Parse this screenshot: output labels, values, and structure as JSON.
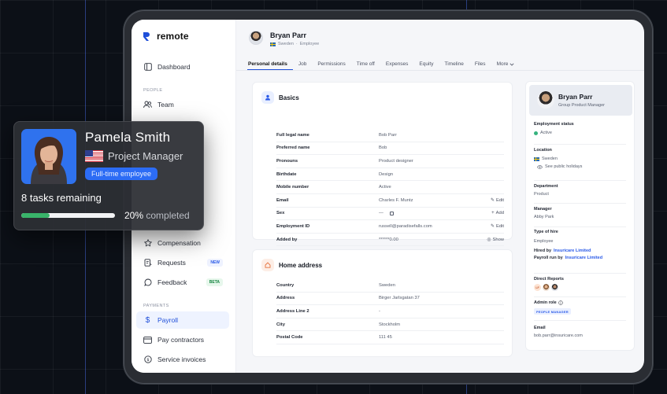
{
  "app": {
    "brand": "remote"
  },
  "sidebar": {
    "items": [
      {
        "label": "Dashboard",
        "icon": "layout-icon"
      },
      {
        "label": "Team",
        "icon": "users-icon"
      },
      {
        "label": "Compensation",
        "icon": "star-icon"
      },
      {
        "label": "Requests",
        "icon": "requests-icon",
        "badge": "NEW"
      },
      {
        "label": "Feedback",
        "icon": "chat-bubble-icon",
        "badge": "BETA"
      },
      {
        "label": "Payroll",
        "icon": "dollar-icon",
        "active": true
      },
      {
        "label": "Pay contractors",
        "icon": "card-icon"
      },
      {
        "label": "Service invoices",
        "icon": "invoice-icon"
      }
    ],
    "sections": {
      "people": "PEOPLE",
      "payments": "PAYMENTS"
    }
  },
  "header": {
    "name": "Bryan Parr",
    "country": "Sweden",
    "type": "Employee",
    "separator": "·",
    "tabs": [
      "Personal details",
      "Job",
      "Permissions",
      "Time off",
      "Expenses",
      "Equity",
      "Timeline",
      "Files",
      "More"
    ],
    "active_tab": "Personal details"
  },
  "basics": {
    "title": "Basics",
    "rows": [
      {
        "label": "Full legal name",
        "value": "Bob Parr",
        "action": ""
      },
      {
        "label": "Preferred name",
        "value": "Bob",
        "action": ""
      },
      {
        "label": "Pronouns",
        "value": "Product designer",
        "action": ""
      },
      {
        "label": "Birthdate",
        "value": "Design",
        "action": ""
      },
      {
        "label": "Mobile number",
        "value": "Active",
        "action": ""
      },
      {
        "label": "Email",
        "value": "Charles F. Muntz",
        "action": "Edit"
      },
      {
        "label": "Sex",
        "value": "—",
        "action": "Add"
      },
      {
        "label": "Employment ID",
        "value": "russell@paradisefalls.com",
        "action": "Edit"
      },
      {
        "label": "Added by",
        "value": "******0.00",
        "action": "Show"
      }
    ]
  },
  "home_address": {
    "title": "Home address",
    "rows": [
      {
        "label": "Country",
        "value": "Sweden"
      },
      {
        "label": "Address",
        "value": "Birger Jarlsgatan 37"
      },
      {
        "label": "Address Line 2",
        "value": "-"
      },
      {
        "label": "City",
        "value": "Stockholm"
      },
      {
        "label": "Postal Code",
        "value": "111 45"
      }
    ]
  },
  "profile_panel": {
    "name": "Bryan Parr",
    "role": "Group Product Manager",
    "employment_status": {
      "label": "Employment status",
      "value": "Active",
      "color": "#36b37e"
    },
    "location": {
      "label": "Location",
      "value": "Sweden",
      "link": "See public holidays"
    },
    "department": {
      "label": "Department",
      "value": "Product"
    },
    "manager": {
      "label": "Manager",
      "value": "Abby Park"
    },
    "type_of_hire": {
      "label": "Type of hire",
      "value": "Employee",
      "hired_by_prefix": "Hired by",
      "hired_by": "Insuricare Limited",
      "payroll_prefix": "Payroll run by",
      "payroll_by": "Insuricare Limited"
    },
    "direct_reports": {
      "label": "Direct Reports",
      "initials": "LF"
    },
    "admin_role": {
      "label": "Admin role",
      "badge": "PEOPLE MANAGER"
    },
    "email": {
      "label": "Email",
      "value": "bob.parr@insuricare.com"
    }
  },
  "float_card": {
    "name": "Pamela Smith",
    "role": "Project Manager",
    "badge": "Full-time employee",
    "tasks": "8 tasks remaining",
    "progress": 0.2,
    "progress_pct": "20%",
    "progress_suffix": " completed"
  },
  "colors": {
    "accent": "#1f4fd9",
    "badge_blue": "#2c6cf5",
    "progress_green": "#39b46a"
  }
}
